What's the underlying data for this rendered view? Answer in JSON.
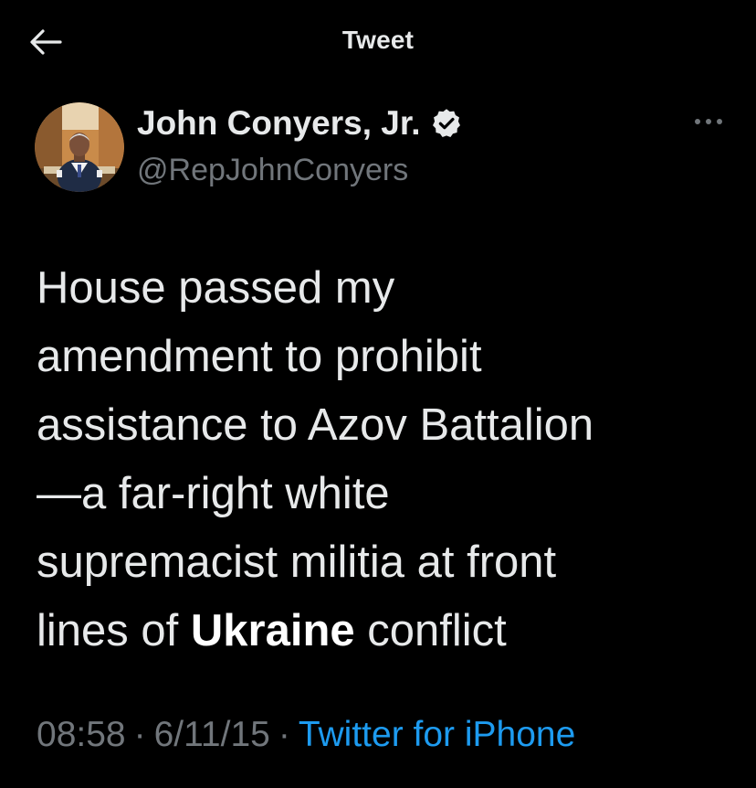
{
  "header": {
    "title": "Tweet",
    "back_icon": "arrow-left-icon"
  },
  "author": {
    "display_name": "John Conyers, Jr.",
    "handle": "@RepJohnConyers",
    "verified_icon": "verified-badge-icon",
    "more_icon": "more-horizontal-icon"
  },
  "tweet": {
    "line1": "House passed my",
    "line2": "amendment to prohibit",
    "line3": "assistance to Azov Battalion",
    "line4": "—a far-right white",
    "line5": "supremacist militia at front",
    "line6_pre": "lines of ",
    "line6_bold": "Ukraine",
    "line6_post": " conflict"
  },
  "meta": {
    "time": "08:58",
    "separator": "·",
    "date": "6/11/15",
    "source": "Twitter for iPhone"
  },
  "colors": {
    "background": "#000000",
    "text": "#e7e9ea",
    "secondary": "#71767b",
    "link": "#1d9bf0"
  }
}
